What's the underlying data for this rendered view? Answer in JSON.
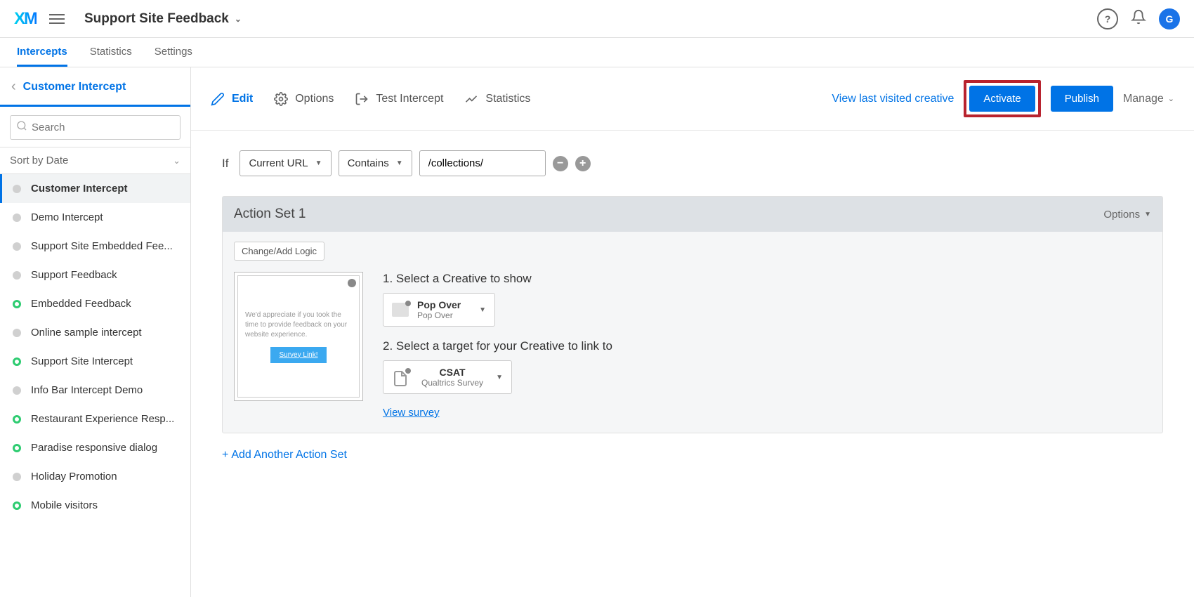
{
  "header": {
    "logo": "XM",
    "project_title": "Support Site Feedback",
    "avatar_letter": "G"
  },
  "tabs": [
    {
      "label": "Intercepts",
      "active": true
    },
    {
      "label": "Statistics",
      "active": false
    },
    {
      "label": "Settings",
      "active": false
    }
  ],
  "sidebar": {
    "title": "Customer Intercept",
    "search_placeholder": "Search",
    "sort_label": "Sort by Date",
    "items": [
      {
        "label": "Customer Intercept",
        "status": "gray",
        "active": true
      },
      {
        "label": "Demo Intercept",
        "status": "gray",
        "active": false
      },
      {
        "label": "Support Site Embedded Fee...",
        "status": "gray",
        "active": false
      },
      {
        "label": "Support Feedback",
        "status": "gray",
        "active": false
      },
      {
        "label": "Embedded Feedback",
        "status": "green",
        "active": false
      },
      {
        "label": "Online sample intercept",
        "status": "gray",
        "active": false
      },
      {
        "label": "Support Site Intercept",
        "status": "green",
        "active": false
      },
      {
        "label": "Info Bar Intercept Demo",
        "status": "gray",
        "active": false
      },
      {
        "label": "Restaurant Experience Resp...",
        "status": "green",
        "active": false
      },
      {
        "label": "Paradise responsive dialog",
        "status": "green",
        "active": false
      },
      {
        "label": "Holiday Promotion",
        "status": "gray",
        "active": false
      },
      {
        "label": "Mobile visitors",
        "status": "green",
        "active": false
      }
    ]
  },
  "toolbar": {
    "edit": "Edit",
    "options": "Options",
    "test": "Test Intercept",
    "stats": "Statistics",
    "view_creative": "View last visited creative",
    "activate": "Activate",
    "publish": "Publish",
    "manage": "Manage"
  },
  "condition": {
    "if_label": "If",
    "field": "Current URL",
    "operator": "Contains",
    "value": "/collections/"
  },
  "action_set": {
    "title": "Action Set 1",
    "options_label": "Options",
    "change_logic": "Change/Add Logic",
    "preview": {
      "text": "We'd appreciate if you took the time to provide feedback on your website experience.",
      "button": "Survey Link!"
    },
    "step1_label": "1. Select a Creative to show",
    "creative": {
      "title": "Pop Over",
      "sub": "Pop Over"
    },
    "step2_label": "2. Select a target for your Creative to link to",
    "target": {
      "title": "CSAT",
      "sub": "Qualtrics Survey"
    },
    "view_survey": "View survey"
  },
  "add_action": "Add Another Action Set"
}
